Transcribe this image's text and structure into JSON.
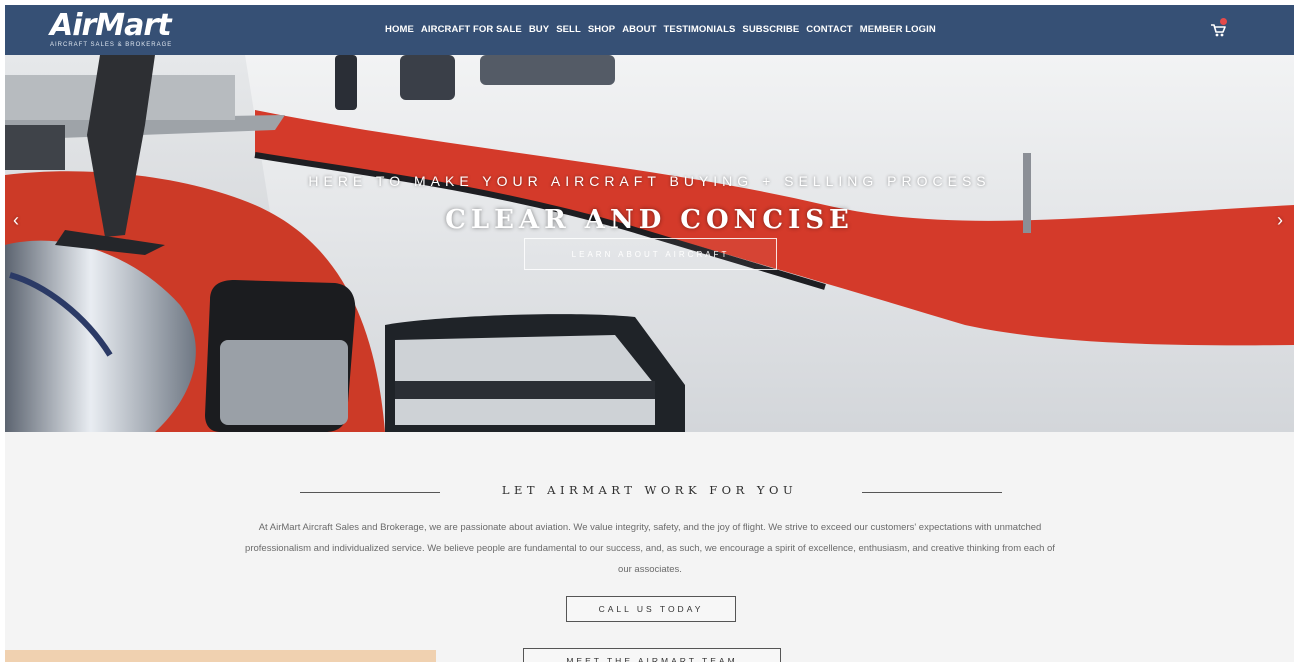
{
  "header": {
    "logo_text": "AirMart",
    "logo_subtext": "AIRCRAFT SALES & BROKERAGE",
    "nav_items": [
      "HOME",
      "AIRCRAFT FOR SALE",
      "BUY",
      "SELL",
      "SHOP",
      "ABOUT",
      "TESTIMONIALS",
      "SUBSCRIBE",
      "CONTACT",
      "MEMBER LOGIN"
    ],
    "cart_icon": "shopping-cart-icon",
    "bg_color": "#365075"
  },
  "hero": {
    "tagline": "HERE TO MAKE YOUR AIRCRAFT BUYING + SELLING PROCESS",
    "title": "CLEAR AND CONCISE",
    "button_label": "LEARN ABOUT AIRCRAFT",
    "prev_icon": "‹",
    "next_icon": "›"
  },
  "intro": {
    "heading": "LET AIRMART WORK FOR YOU",
    "body": "At AirMart Aircraft Sales and Brokerage, we are passionate about aviation. We value integrity, safety, and the joy of flight. We strive to exceed our customers' expectations with unmatched professionalism and individualized service. We believe people are fundamental to our success, and, as such, we encourage a spirit of excellence, enthusiasm, and creative thinking from each of our associates.",
    "call_button": "CALL US TODAY",
    "team_button": "MEET THE AIRMART TEAM"
  }
}
